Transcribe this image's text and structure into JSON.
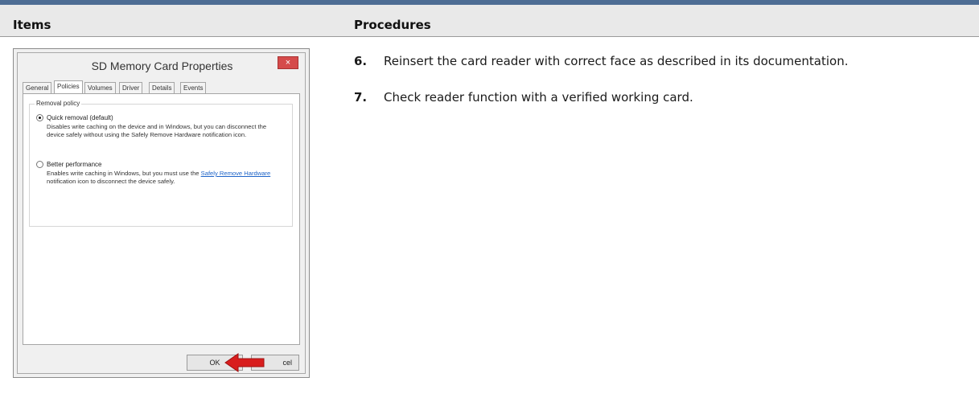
{
  "table": {
    "headers": {
      "items": "Items",
      "procedures": "Procedures"
    },
    "accent_color": "#4e6d94"
  },
  "screenshot": {
    "title": "SD Memory Card Properties",
    "close_glyph": "×",
    "tabs": [
      "General",
      "Policies",
      "Volumes",
      "Driver",
      "Details",
      "Events"
    ],
    "active_tab": "Policies",
    "group_label": "Removal policy",
    "options": [
      {
        "label": "Quick removal (default)",
        "selected": true,
        "description": "Disables write caching on the device and in Windows, but you can disconnect the device safely without using the Safely Remove Hardware notification icon."
      },
      {
        "label": "Better performance",
        "selected": false,
        "description_pre": "Enables write caching in Windows, but you must use the",
        "description_link": "Safely Remove Hardware",
        "description_post": "notification icon to disconnect the device safely."
      }
    ],
    "ok_label": "OK",
    "cancel_label": "Cancel",
    "cancel_visible_fragment": "cel",
    "arrow_color": "#d81e1e",
    "arrow_icon": "red-arrow-icon"
  },
  "procedures": [
    {
      "number": "6.",
      "text": "Reinsert the card reader with correct face as described in its documentation."
    },
    {
      "number": "7.",
      "text": "Check reader function with a verified working card."
    }
  ]
}
